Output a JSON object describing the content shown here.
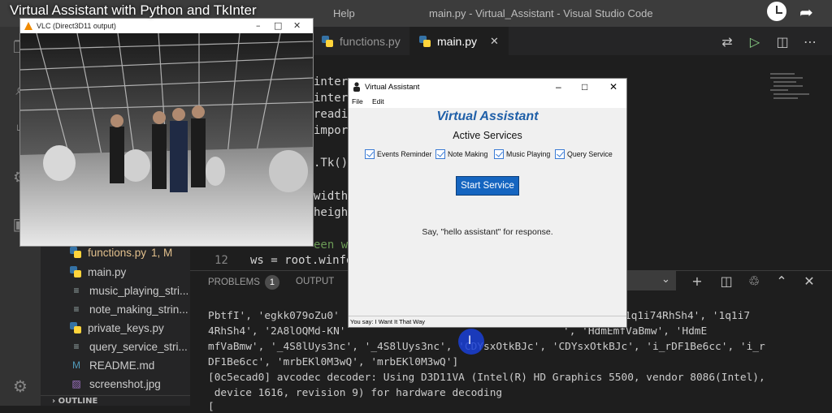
{
  "youtube": {
    "title": "Virtual Assistant with Python and TkInter"
  },
  "vscode": {
    "menu_help": "Help",
    "window_title": "main.py - Virtual_Assistant - Visual Studio Code",
    "tabs": [
      {
        "label": "functions.py"
      },
      {
        "label": "main.py",
        "active": true
      }
    ],
    "code_fragments": [
      "inter",
      "inter",
      "readi",
      "import",
      ".Tk()",
      "width",
      "heigh",
      "een w"
    ],
    "line_12": {
      "number": "12",
      "text": "ws = root.winfo"
    },
    "explorer": {
      "files": [
        {
          "name": "functions.py",
          "badge": "1, M",
          "icon": "python-icon"
        },
        {
          "name": "main.py",
          "icon": "python-icon"
        },
        {
          "name": "music_playing_stri...",
          "icon": "file-icon"
        },
        {
          "name": "note_making_strin...",
          "icon": "file-icon"
        },
        {
          "name": "private_keys.py",
          "icon": "python-icon"
        },
        {
          "name": "query_service_stri...",
          "icon": "file-icon"
        },
        {
          "name": "README.md",
          "icon": "markdown-icon"
        },
        {
          "name": "screenshot.jpg",
          "icon": "image-icon"
        }
      ],
      "outline_label": "OUTLINE"
    },
    "panel": {
      "tabs": [
        {
          "label": "PROBLEMS",
          "badge": "1"
        },
        {
          "label": "OUTPUT"
        }
      ],
      "terminal_lines": [
        "PbtfI', 'egkk079oZu0'",
        "4RhSh4', '2A8lOQMd-KN'",
        "mfVaBmw', '_4S8lUys3nc', '_4S8lUys3nc', 'CDYsxOtkBJc', 'CDYsxOtkBJc', 'i_rDF1Be6cc', 'i_r",
        "DF1Be6cc', 'mrbEKl0M3wQ', 'mrbEKl0M3wQ']",
        "[0c5ecad0] avcodec decoder: Using D3D11VA (Intel(R) HD Graphics 5500, vendor 8086(Intel),",
        " device 1616, revision 9) for hardware decoding",
        "["
      ],
      "terminal_right_1": "LJw', '1q1i74RhSh4', '1q1i7",
      "terminal_right_2": "', 'HdmEmfVaBmw', 'HdmE"
    }
  },
  "vlc": {
    "title": "VLC (Direct3D11 output)"
  },
  "assistant": {
    "window_title": "Virtual Assistant",
    "menu": [
      "File",
      "Edit"
    ],
    "heading": "Virtual Assistant",
    "subheading": "Active Services",
    "services": [
      {
        "label": "Events Reminder",
        "checked": true
      },
      {
        "label": "Note Making",
        "checked": true
      },
      {
        "label": "Music Playing",
        "checked": true
      },
      {
        "label": "Query Service",
        "checked": true
      }
    ],
    "start_button": "Start Service",
    "hint": "Say, \"hello assistant\" for response.",
    "status": "You say: I Want It That Way"
  },
  "colors": {
    "accent_blue": "#1565c0",
    "heading_blue": "#1f5fa8",
    "vscode_bg": "#1e1e1e"
  }
}
